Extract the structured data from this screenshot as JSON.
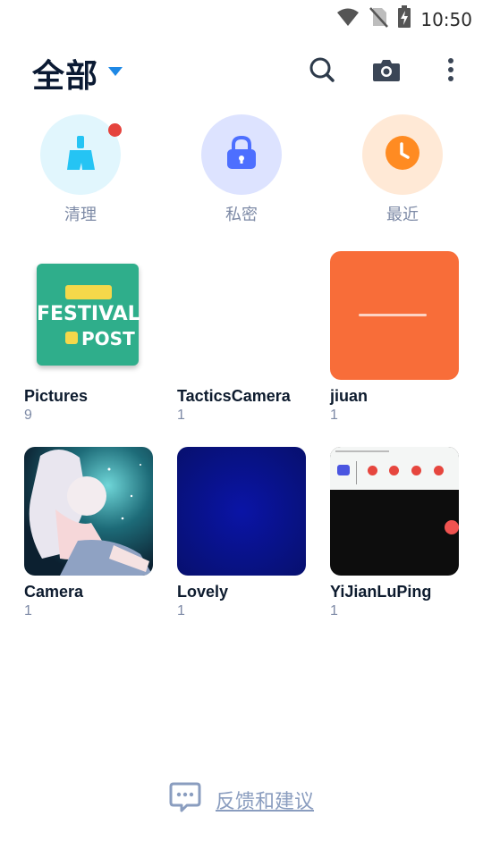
{
  "status": {
    "time": "10:50"
  },
  "header": {
    "title": "全部"
  },
  "quick_actions": [
    {
      "label": "清理",
      "color": "#25c4f4",
      "bg": "#e1f6fd",
      "has_badge": true
    },
    {
      "label": "私密",
      "color": "#4d6fff",
      "bg": "#dde3ff"
    },
    {
      "label": "最近",
      "color": "#ff8b22",
      "bg": "#ffe9d6"
    }
  ],
  "albums": [
    {
      "name": "Pictures",
      "count": "9",
      "thumb_text_1": "FESTIVAL",
      "thumb_text_2": "POST",
      "thumb_bg": "#2fae8b"
    },
    {
      "name": "TacticsCamera",
      "count": "1"
    },
    {
      "name": "jiuan",
      "count": "1",
      "thumb_bg": "#f86d39"
    },
    {
      "name": "Camera",
      "count": "1"
    },
    {
      "name": "Lovely",
      "count": "1",
      "thumb_bg": "#0a148f"
    },
    {
      "name": "YiJianLuPing",
      "count": "1"
    }
  ],
  "feedback": {
    "label": "反馈和建议"
  },
  "colors": {
    "accent": "#1e88e5",
    "text_primary": "#0d1b2e",
    "text_secondary": "#7d8aa6"
  }
}
